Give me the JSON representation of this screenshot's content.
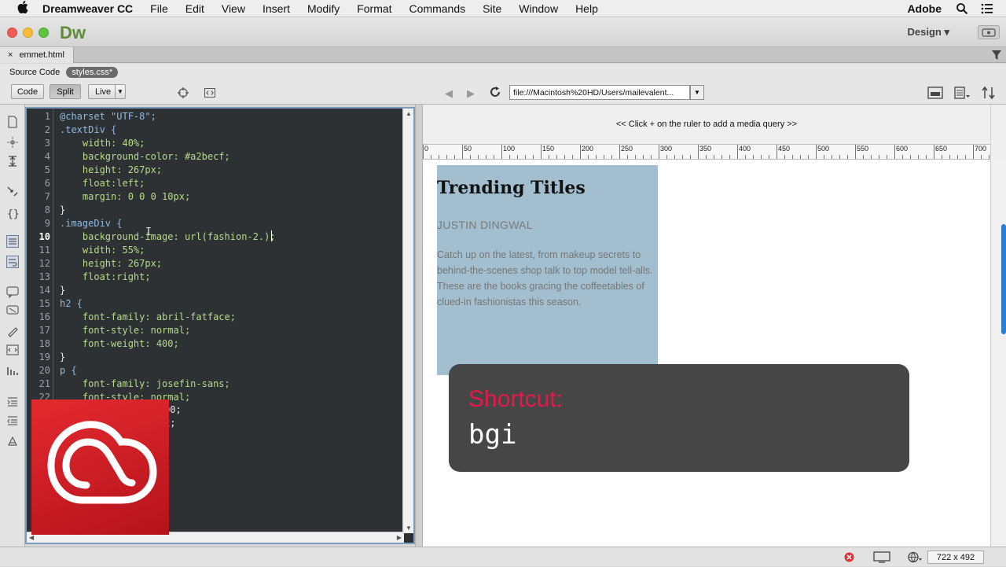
{
  "menubar": {
    "app_name": "Dreamweaver CC",
    "items": [
      "File",
      "Edit",
      "View",
      "Insert",
      "Modify",
      "Format",
      "Commands",
      "Site",
      "Window",
      "Help"
    ],
    "right_label": "Adobe"
  },
  "titlebar": {
    "app_logo": "Dw",
    "workspace": "Design ▾"
  },
  "doc_tab": {
    "close": "×",
    "filename": "emmet.html"
  },
  "related_files": {
    "source_label": "Source Code",
    "css_file": "styles.css*"
  },
  "toolbar": {
    "code_label": "Code",
    "split_label": "Split",
    "live_label": "Live",
    "live_arrow": "▼",
    "back": "◀",
    "forward": "▶",
    "url": "file:///Macintosh%20HD/Users/mailevalent...",
    "url_arrow": "▼"
  },
  "code": {
    "line_numbers": [
      "1",
      "2",
      "3",
      "4",
      "5",
      "6",
      "7",
      "8",
      "9",
      "10",
      "11",
      "12",
      "13",
      "14",
      "15",
      "16",
      "17",
      "18",
      "19",
      "20",
      "21",
      "22"
    ],
    "current_line": "10",
    "lines": [
      "@charset \"UTF-8\";",
      ".textDiv {",
      "    width: 40%;",
      "    background-color: #a2becf;",
      "    height: 267px;",
      "    float:left;",
      "    margin: 0 0 0 10px;",
      "}",
      ".imageDiv {",
      "    background-image: url(fashion-2.);",
      "    width: 55%;",
      "    height: 267px;",
      "    float:right;",
      "}",
      "h2 {",
      "    font-family: abril-fatface;",
      "    font-style: normal;",
      "    font-weight: 400;",
      "}",
      "p {",
      "    font-family: josefin-sans;",
      "    font-style: normal;"
    ],
    "partial_lines": [
      "00;",
      "x;",
      ";"
    ]
  },
  "design": {
    "media_query_hint": "<< Click + on the ruler to add a media query >>",
    "ruler_labels": [
      "0",
      "50",
      "100",
      "150",
      "200",
      "250",
      "300",
      "350",
      "400",
      "450",
      "500",
      "550",
      "600",
      "650",
      "700"
    ],
    "heading": "Trending Titles",
    "author": "JUSTIN DINGWAL",
    "blurb": "Catch up on the latest, from makeup secrets to behind-the-scenes shop talk to top model tell-alls. These are the books gracing the coffeetables of clued-in fashionistas this season."
  },
  "status": {
    "window_size": "722 x 492"
  },
  "shortcut": {
    "label": "Shortcut:",
    "keys": "bgi"
  },
  "colors": {
    "textdiv_bg": "#a2becf",
    "shortcut_label": "#e7194a",
    "cc_red": "#d8202a"
  }
}
